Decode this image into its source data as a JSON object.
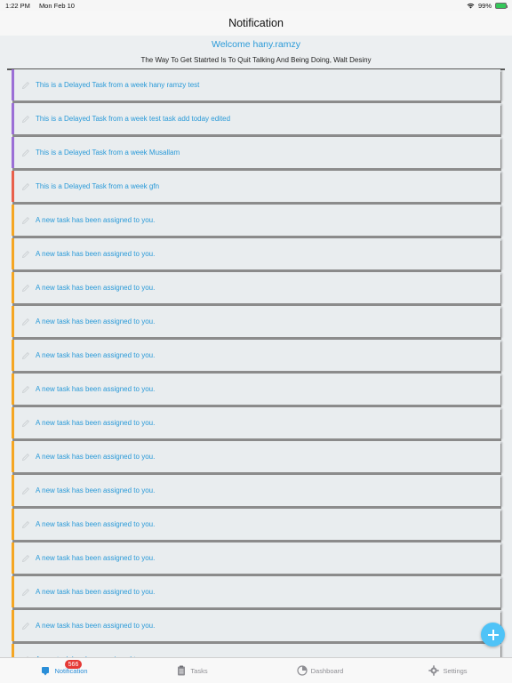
{
  "status_bar": {
    "time": "1:22 PM",
    "date": "Mon Feb 10",
    "battery": "99%"
  },
  "nav": {
    "title": "Notification"
  },
  "header": {
    "welcome": "Welcome hany.ramzy",
    "quote": "The Way To Get Statrted Is To Quit Talking And Being Doing, Walt Desiny"
  },
  "notifications": [
    {
      "text": "This is a Delayed Task from a week hany ramzy test",
      "accent": "#9b6fd6"
    },
    {
      "text": "This is a Delayed Task from a week test task add today edited",
      "accent": "#9b6fd6"
    },
    {
      "text": "This is a Delayed Task from a week Musallam",
      "accent": "#9b6fd6"
    },
    {
      "text": "This is a Delayed Task from a week gfn",
      "accent": "#e8604c"
    },
    {
      "text": "A new task has been assigned to you.",
      "accent": "#f5a623"
    },
    {
      "text": "A new task has been assigned to you.",
      "accent": "#f5a623"
    },
    {
      "text": "A new task has been assigned to you.",
      "accent": "#f5a623"
    },
    {
      "text": "A new task has been assigned to you.",
      "accent": "#f5a623"
    },
    {
      "text": "A new task has been assigned to you.",
      "accent": "#f5a623"
    },
    {
      "text": "A new task has been assigned to you.",
      "accent": "#f5a623"
    },
    {
      "text": "A new task has been assigned to you.",
      "accent": "#f5a623"
    },
    {
      "text": "A new task has been assigned to you.",
      "accent": "#f5a623"
    },
    {
      "text": "A new task has been assigned to you.",
      "accent": "#f5a623"
    },
    {
      "text": "A new task has been assigned to you.",
      "accent": "#f5a623"
    },
    {
      "text": "A new task has been assigned to you.",
      "accent": "#f5a623"
    },
    {
      "text": "A new task has been assigned to you.",
      "accent": "#f5a623"
    },
    {
      "text": "A new task has been assigned to you.",
      "accent": "#f5a623"
    },
    {
      "text": "A new task has been assigned to you.",
      "accent": "#f5a623"
    }
  ],
  "fab": {
    "icon": "plus-icon"
  },
  "tab_bar": {
    "badge": "566",
    "tabs": [
      {
        "label": "Notification",
        "icon": "notification-icon",
        "active": true
      },
      {
        "label": "Tasks",
        "icon": "clipboard-icon",
        "active": false
      },
      {
        "label": "Dashboard",
        "icon": "pie-chart-icon",
        "active": false
      },
      {
        "label": "Settings",
        "icon": "gear-icon",
        "active": false
      }
    ]
  },
  "colors": {
    "accent_blue": "#2a9ad8",
    "fab": "#4fc3f7",
    "badge": "#e53935"
  }
}
